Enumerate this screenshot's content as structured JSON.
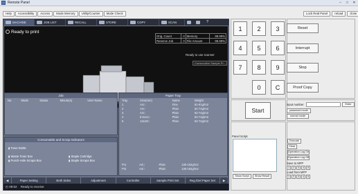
{
  "window": {
    "title": "Remote Panel"
  },
  "menu": [
    "Help",
    "Accessibility",
    "Access",
    "Mode Memory",
    "Utility/Counter",
    "Mode Check"
  ],
  "top_right": [
    "Lock Real Panel",
    "reload",
    "close"
  ],
  "tabs": {
    "machine": "MACHINE",
    "job_list": "JOB LIST",
    "recall": "RECALL",
    "store": "STORE",
    "copy": "COPY",
    "scan": "SCAN"
  },
  "screen": {
    "status": "Ready to print",
    "info": [
      {
        "label": "Orig. Count",
        "value": "0",
        "label2": "Memory",
        "value2": "99.99%"
      },
      {
        "label": "Reserve Job",
        "value": "0",
        "label2": "File Amount",
        "value2": "99.99%"
      }
    ],
    "scan_msg": "Ready to use scanner",
    "sample_button": "Consecutive Sample Pr..."
  },
  "job_panel": {
    "title": "Job",
    "columns": [
      "No.",
      "Mode",
      "Status",
      "Minute(s)",
      "User Name"
    ]
  },
  "tray_panel": {
    "title": "Paper Tray",
    "columns": [
      "Tray",
      "Size(mm)",
      "Name",
      "Weight"
    ],
    "rows": [
      [
        "1",
        "A4□",
        "Fine",
        "81-91g/m2"
      ],
      [
        "2",
        "A4□",
        "Plain",
        "62-74g/m2"
      ],
      [
        "3",
        "A3□",
        "Plain",
        "62-74g/m2"
      ],
      [
        "4",
        "8.5x11□",
        "Plain",
        "62-74g/m2"
      ],
      [
        "5",
        "13x18□",
        "Plain",
        "62-74g/m2"
      ]
    ],
    "rows2": [
      [
        "PI1",
        "A4□",
        "Plain",
        "136-162g/m2"
      ],
      [
        "PI2",
        "A4□",
        "Plain",
        "136-162g/m2"
      ]
    ]
  },
  "consumables": {
    "title": "Consumable and Scrap Indicators",
    "items": [
      "Toner Bottle",
      "Waste Toner Box",
      "Punch-Hole Scraps Box",
      "Staple Cartridge",
      "Staple Scraps Box"
    ]
  },
  "bottom_bar": [
    "Paper Setting",
    "Both Sides",
    "Adjustment",
    "Controller",
    "Sample Print Set",
    "Reg./Del Paper Set"
  ],
  "status_bar": {
    "time": "08:52",
    "message": "Ready to receive"
  },
  "keypad": {
    "keys": [
      "1",
      "2",
      "3",
      "4",
      "5",
      "6",
      "7",
      "8",
      "9",
      "0",
      "C"
    ],
    "reset": "Reset",
    "interrupt": "Interrupt",
    "stop": "Stop",
    "proof_copy": "Proof Copy",
    "start": "Start"
  },
  "input_panel": {
    "label": "input number",
    "enter": "Enter",
    "password_mode": "password mode",
    "normal_mode": "normal mode"
  },
  "script_panel": {
    "title": "Panel Script",
    "execute": "Execute",
    "clear": "Clear",
    "operation_log_on": "Operation Log On",
    "operation_log_off": "Operation Log Off",
    "save_label": "Save to MFP",
    "load_label": "Load from MFP",
    "slots": [
      "1",
      "2",
      "3",
      "4",
      "5"
    ],
    "show_script": "Show Script",
    "show_result": "Show Result"
  }
}
